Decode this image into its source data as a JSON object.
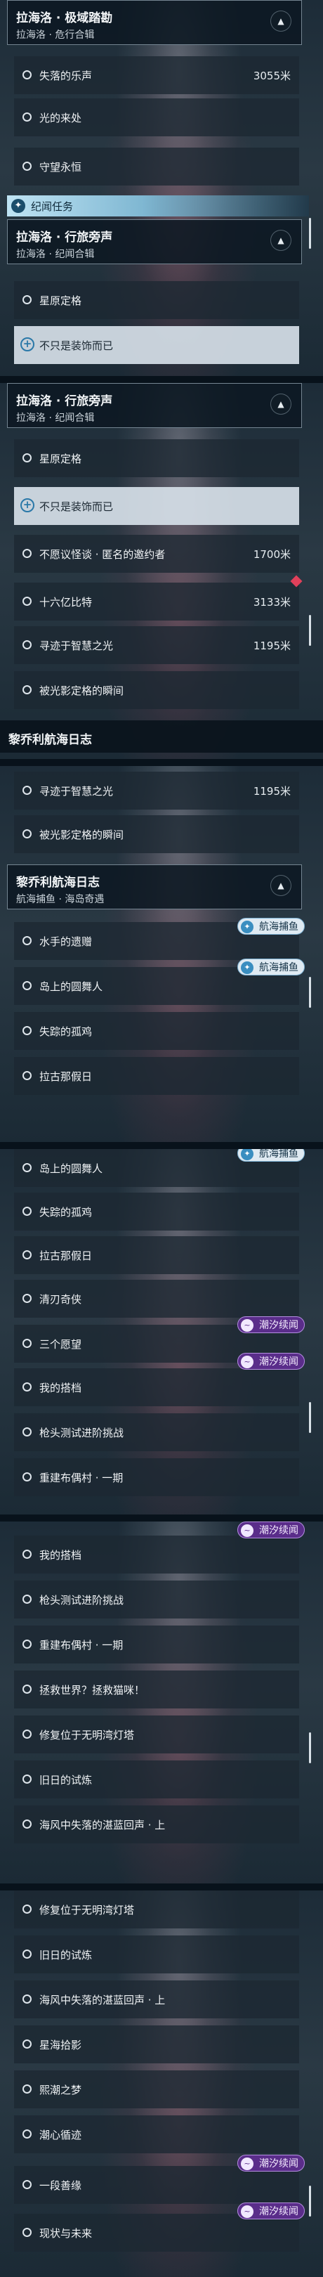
{
  "sections": [
    {
      "header": {
        "title": "拉海洛 · 极域踏勘",
        "subtitle": "拉海洛 · 危行合辑"
      },
      "items": [
        {
          "label": "失落的乐声",
          "distance": "3055米"
        },
        {
          "label": "光的来处"
        },
        {
          "label": "守望永恒"
        }
      ],
      "section_bar": "纪闻任务",
      "header2": {
        "title": "拉海洛 · 行旅旁声",
        "subtitle": "拉海洛 · 纪闻合辑"
      },
      "items2": [
        {
          "label": "星原定格"
        },
        {
          "label": "不只是装饰而已"
        }
      ]
    },
    {
      "header": {
        "title": "拉海洛 · 行旅旁声",
        "subtitle": "拉海洛 · 纪闻合辑"
      },
      "items": [
        {
          "label": "星原定格"
        },
        {
          "label": "不只是装饰而已"
        },
        {
          "label": "不愿议怪谈 · 匿名的邀约者",
          "distance": "1700米"
        },
        {
          "label": "十六亿比特",
          "distance": "3133米"
        },
        {
          "label": "寻迹于智慧之光",
          "distance": "1195米"
        },
        {
          "label": "被光影定格的瞬间"
        }
      ],
      "footer_heading": "黎乔利航海日志"
    },
    {
      "items_top": [
        {
          "label": "寻迹于智慧之光",
          "distance": "1195米"
        },
        {
          "label": "被光影定格的瞬间"
        }
      ],
      "header": {
        "title": "黎乔利航海日志",
        "subtitle": "航海捕鱼 · 海岛奇遇"
      },
      "items": [
        {
          "label": "水手的遗赠",
          "badge": "航海捕鱼"
        },
        {
          "label": "岛上的圆舞人",
          "badge": "航海捕鱼"
        },
        {
          "label": "失踪的孤鸡"
        },
        {
          "label": "拉古那假日"
        }
      ]
    },
    {
      "items": [
        {
          "label": "岛上的圆舞人",
          "badge": "航海捕鱼"
        },
        {
          "label": "失踪的孤鸡"
        },
        {
          "label": "拉古那假日"
        },
        {
          "label": "清刃奇侠"
        },
        {
          "label": "三个愿望",
          "badge": "潮汐续闻"
        },
        {
          "label": "我的搭档",
          "badge": "潮汐续闻"
        },
        {
          "label": "枪头测试进阶挑战"
        },
        {
          "label": "重建布偶村 · 一期"
        }
      ]
    },
    {
      "items": [
        {
          "label": "我的搭档",
          "badge": "潮汐续闻"
        },
        {
          "label": "枪头测试进阶挑战"
        },
        {
          "label": "重建布偶村 · 一期"
        },
        {
          "label": "拯救世界？拯救猫咪！"
        },
        {
          "label": "修复位于无明湾灯塔"
        },
        {
          "label": "旧日的试炼"
        },
        {
          "label": "海风中失落的湛蓝回声 · 上"
        }
      ]
    },
    {
      "items": [
        {
          "label": "修复位于无明湾灯塔"
        },
        {
          "label": "旧日的试炼"
        },
        {
          "label": "海风中失落的湛蓝回声 · 上"
        },
        {
          "label": "星海拾影"
        },
        {
          "label": "熙潮之梦"
        },
        {
          "label": "潮心循迹"
        },
        {
          "label": "一段善缘",
          "badge": "潮汐续闻"
        },
        {
          "label": "现状与未来",
          "badge": "潮汐续闻"
        }
      ]
    }
  ],
  "icons": {
    "collapse": "chevron-up-icon",
    "section": "sparkle-icon",
    "radio": "circle-icon",
    "selected": "plus-circle-icon",
    "badge_fish": "fish-icon",
    "badge_wave": "wave-icon"
  },
  "colors": {
    "active_row": "#d6e0e8",
    "badge_blue": "#dfeaf2",
    "badge_purple": "#5a2d8a",
    "marker": "#e0405a"
  }
}
